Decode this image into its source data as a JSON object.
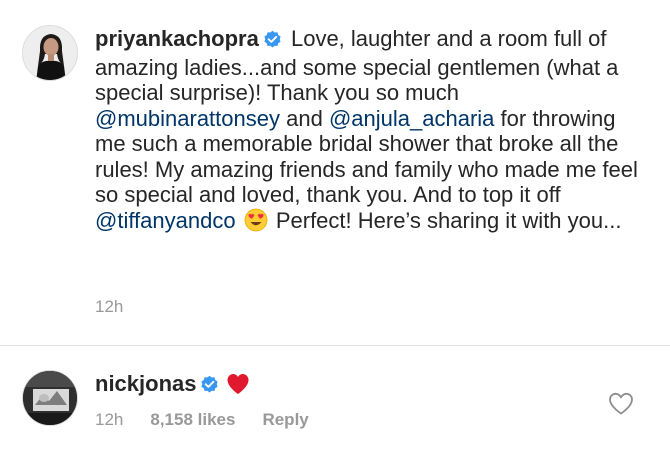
{
  "caption": {
    "username": "priyankachopra",
    "verified_icon": "verified-badge-icon",
    "segments_line_1": "Love, laughter and a room",
    "text_1": "full of amazing ladies...and some special gentlemen (what a special surprise)! Thank you so much",
    "mention_1": "@mubinarattonsey",
    "text_2": "and",
    "mention_2": "@anjula_acharia",
    "text_3": "for throwing me such a memorable bridal shower that broke all the rules! My amazing friends and family who made me feel so special and loved, thank you. And to top it off",
    "mention_3": "@tiffanyandco",
    "emoji": "heart-eyes-emoji",
    "text_4": "Perfect! Here’s sharing it with you...",
    "time": "12h"
  },
  "comment": {
    "username": "nickjonas",
    "verified_icon": "verified-badge-icon",
    "emoji": "red-heart-emoji",
    "time": "12h",
    "likes": "8,158 likes",
    "reply_label": "Reply",
    "like_icon": "heart-outline-icon"
  },
  "colors": {
    "text": "#262626",
    "mention": "#003569",
    "meta": "#999999",
    "verified": "#3897f0",
    "divider": "#e3e3e3",
    "heart": "#ed4956"
  }
}
